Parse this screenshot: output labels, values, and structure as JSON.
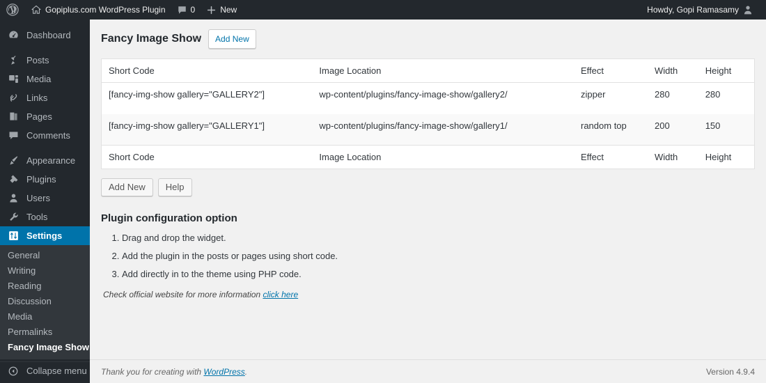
{
  "adminbar": {
    "logo_icon": "wordpress-logo-icon",
    "site_icon": "home-icon",
    "site_name": "Gopiplus.com WordPress Plugin",
    "comments_icon": "comment-bubble-icon",
    "comments_count": "0",
    "new_icon": "plus-icon",
    "new_label": "New",
    "howdy": "Howdy, Gopi Ramasamy",
    "avatar_icon": "user-avatar-icon"
  },
  "sidebar": {
    "items": [
      {
        "label": "Dashboard",
        "icon": "dashboard-icon"
      },
      {
        "label": "Posts",
        "icon": "pin-icon"
      },
      {
        "label": "Media",
        "icon": "media-icon"
      },
      {
        "label": "Links",
        "icon": "link-icon"
      },
      {
        "label": "Pages",
        "icon": "pages-icon"
      },
      {
        "label": "Comments",
        "icon": "comments-icon"
      },
      {
        "label": "Appearance",
        "icon": "brush-icon"
      },
      {
        "label": "Plugins",
        "icon": "plug-icon"
      },
      {
        "label": "Users",
        "icon": "users-icon"
      },
      {
        "label": "Tools",
        "icon": "wrench-icon"
      },
      {
        "label": "Settings",
        "icon": "settings-sliders-icon"
      }
    ],
    "submenu": [
      {
        "label": "General"
      },
      {
        "label": "Writing"
      },
      {
        "label": "Reading"
      },
      {
        "label": "Discussion"
      },
      {
        "label": "Media"
      },
      {
        "label": "Permalinks"
      },
      {
        "label": "Fancy Image Show"
      }
    ],
    "collapse": {
      "label": "Collapse menu",
      "icon": "collapse-arrow-icon"
    },
    "accent_color": "#0073aa",
    "background_color": "#23282d",
    "submenu_background_color": "#32373c"
  },
  "page": {
    "title": "Fancy Image Show",
    "add_new_label": "Add New"
  },
  "table": {
    "columns": [
      "Short Code",
      "Image Location",
      "Effect",
      "Width",
      "Height"
    ],
    "rows": [
      {
        "shortcode": "[fancy-img-show gallery=\"GALLERY2\"]",
        "location": "wp-content/plugins/fancy-image-show/gallery2/",
        "effect": "zipper",
        "width": "280",
        "height": "280"
      },
      {
        "shortcode": "[fancy-img-show gallery=\"GALLERY1\"]",
        "location": "wp-content/plugins/fancy-image-show/gallery1/",
        "effect": "random top",
        "width": "200",
        "height": "150"
      }
    ]
  },
  "actions": {
    "add_new_label": "Add New",
    "help_label": "Help"
  },
  "config": {
    "heading": "Plugin configuration option",
    "steps": [
      "Drag and drop the widget.",
      "Add the plugin in the posts or pages using short code.",
      "Add directly in to the theme using PHP code."
    ],
    "note_text": "Check official website for more information",
    "note_link": "click here"
  },
  "footer": {
    "thanks_prefix": "Thank you for creating with ",
    "thanks_link": "WordPress",
    "thanks_suffix": ".",
    "version": "Version 4.9.4"
  }
}
